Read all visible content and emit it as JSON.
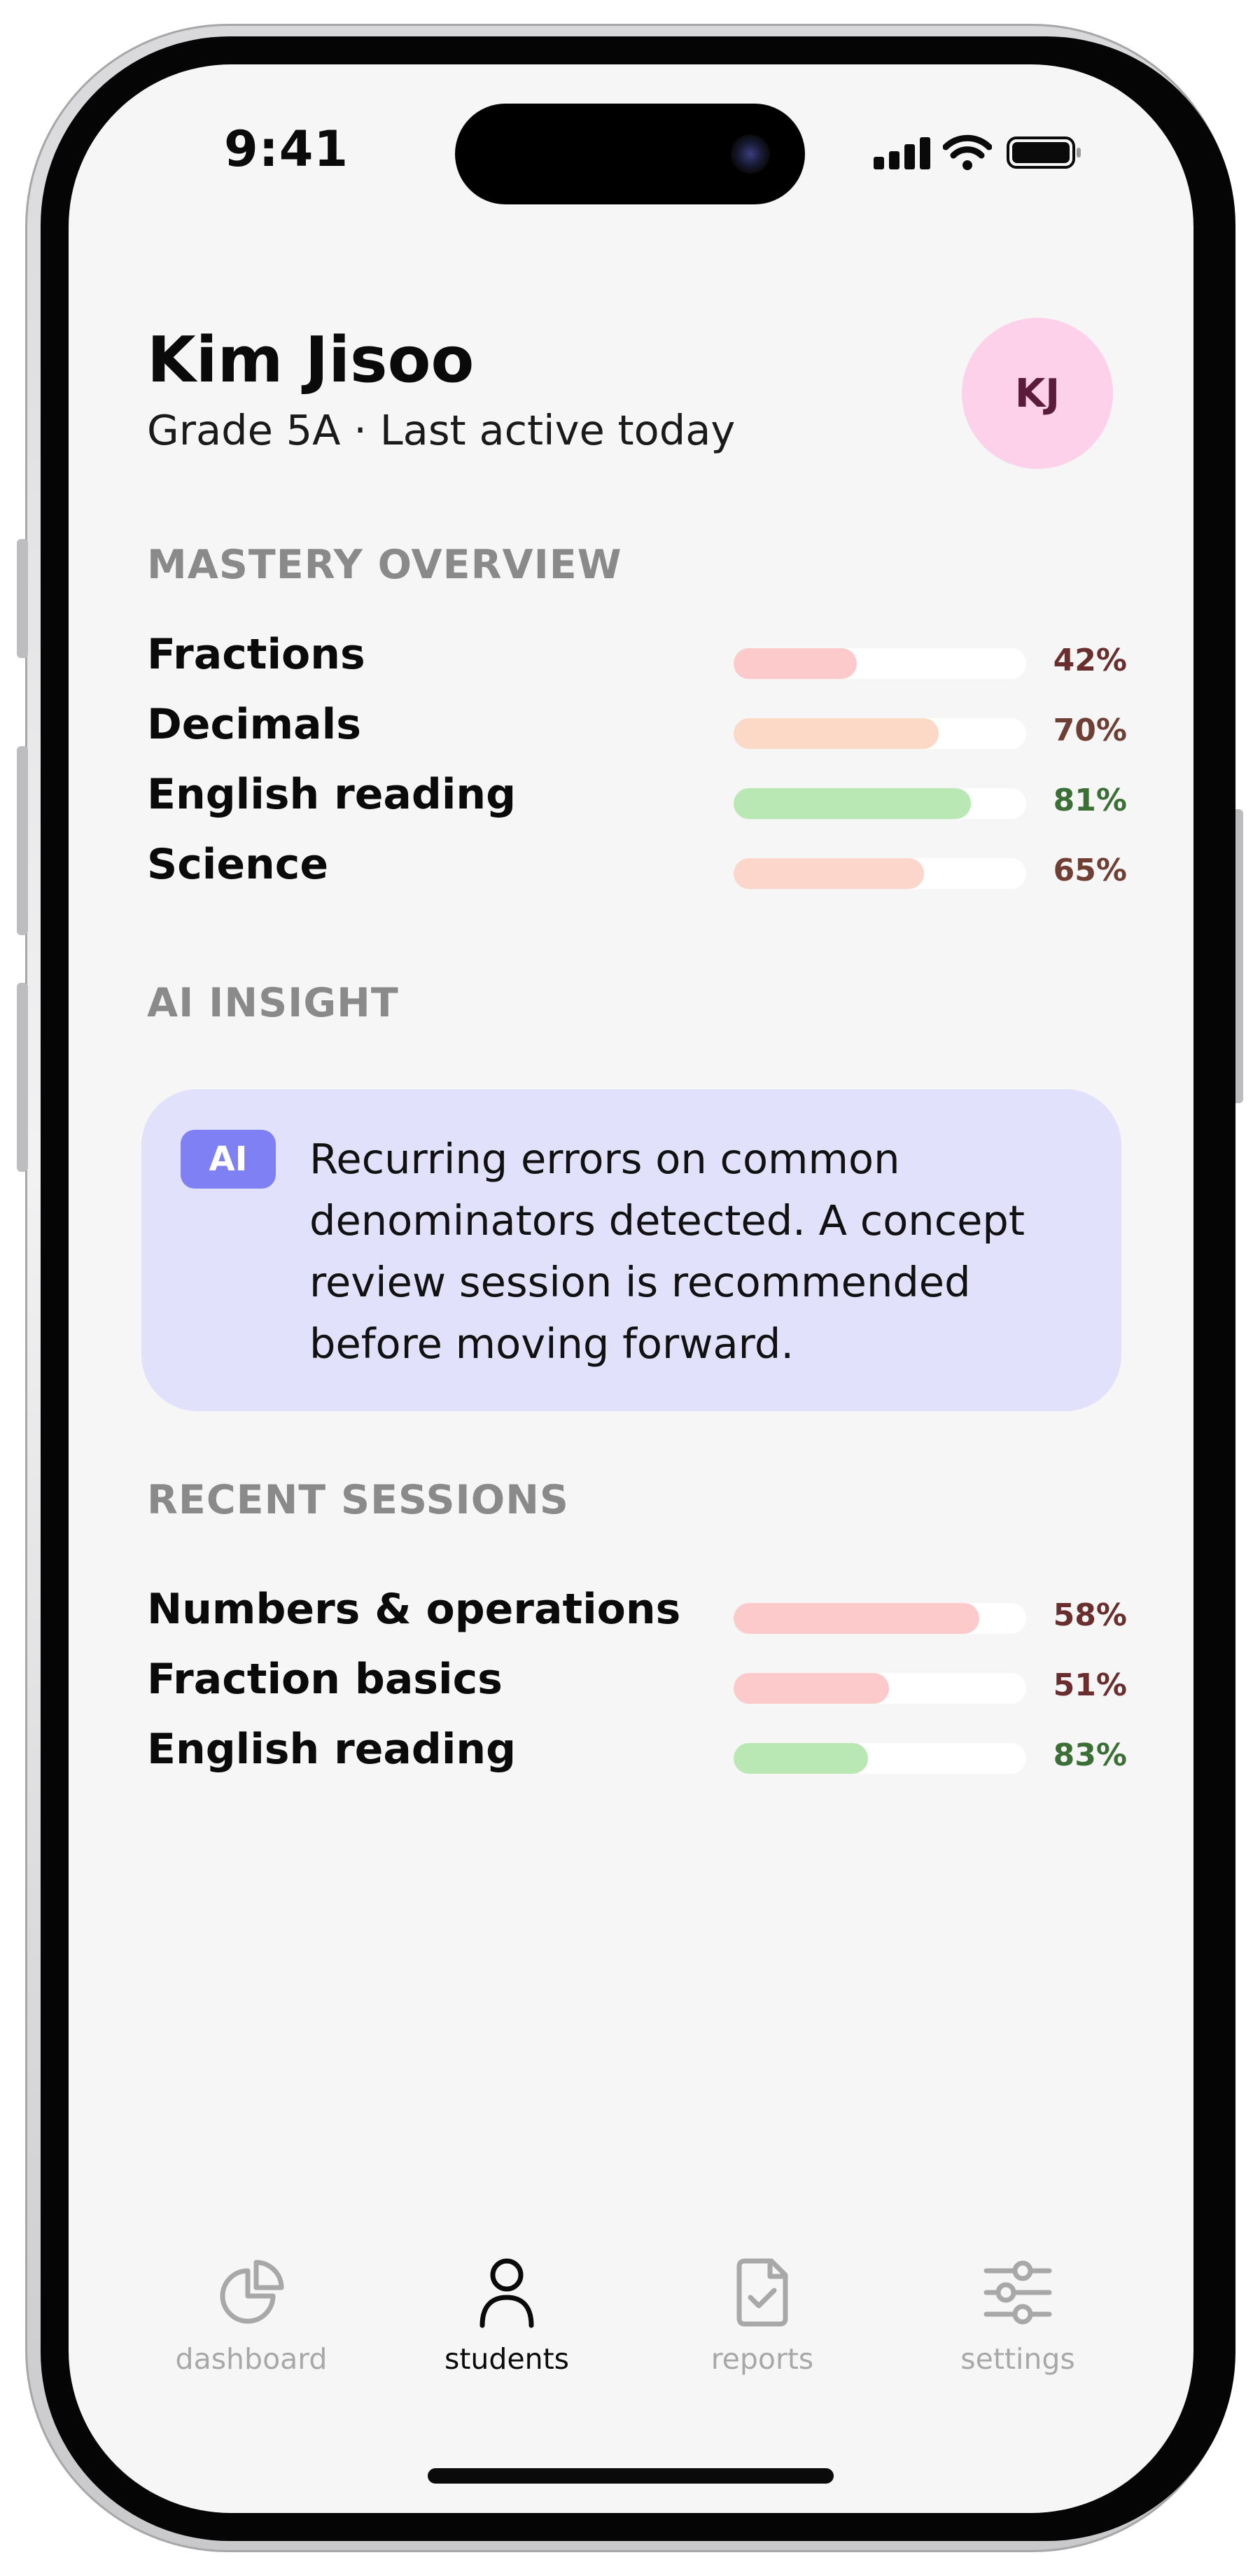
{
  "status_bar": {
    "time": "9:41"
  },
  "profile": {
    "name": "Kim Jisoo",
    "subtitle": "Grade 5A · Last active today",
    "initials": "KJ"
  },
  "mastery": {
    "title": "MASTERY OVERVIEW",
    "items": [
      {
        "label": "Fractions",
        "percent": "42%",
        "value": 42,
        "bar_color": "#fccaca",
        "text_color": "#6b2e2e"
      },
      {
        "label": "Decimals",
        "percent": "70%",
        "value": 70,
        "bar_color": "#fcd9c7",
        "text_color": "#6e3f32"
      },
      {
        "label": "English reading",
        "percent": "81%",
        "value": 81,
        "bar_color": "#b9e8b4",
        "text_color": "#3b6f36"
      },
      {
        "label": "Science",
        "percent": "65%",
        "value": 65,
        "bar_color": "#fcd6ca",
        "text_color": "#6e3f32"
      }
    ]
  },
  "insight": {
    "title": "AI INSIGHT",
    "badge": "AI",
    "text": "Recurring errors on common denominators detected. A concept review session is recommended before moving forward."
  },
  "sessions": {
    "title": "RECENT SESSIONS",
    "items": [
      {
        "label": "Numbers & operations",
        "percent": "58%",
        "value": 84,
        "bar_color": "#fccaca",
        "text_color": "#6b2e2e"
      },
      {
        "label": "Fraction basics",
        "percent": "51%",
        "value": 53,
        "bar_color": "#fccaca",
        "text_color": "#6b2e2e"
      },
      {
        "label": "English reading",
        "percent": "83%",
        "value": 46,
        "bar_color": "#b9e8b4",
        "text_color": "#3b6f36"
      }
    ]
  },
  "nav": {
    "items": [
      {
        "label": "dashboard",
        "icon": "pie-chart-icon",
        "active": false
      },
      {
        "label": "students",
        "icon": "person-icon",
        "active": true
      },
      {
        "label": "reports",
        "icon": "document-check-icon",
        "active": false
      },
      {
        "label": "settings",
        "icon": "sliders-icon",
        "active": false
      }
    ]
  }
}
